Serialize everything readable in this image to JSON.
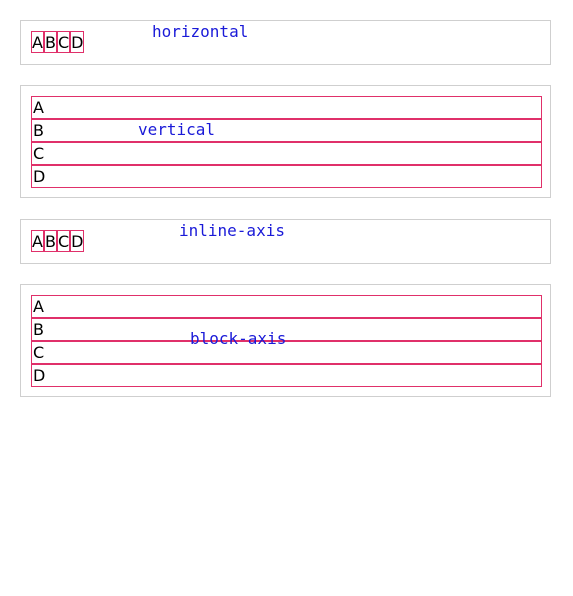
{
  "panels": [
    {
      "caption": "horizontal",
      "items": [
        "A",
        "B",
        "C",
        "D"
      ]
    },
    {
      "caption": "vertical",
      "items": [
        "A",
        "B",
        "C",
        "D"
      ]
    },
    {
      "caption": "inline-axis",
      "items": [
        "A",
        "B",
        "C",
        "D"
      ]
    },
    {
      "caption": "block-axis",
      "items": [
        "A",
        "B",
        "C",
        "D"
      ]
    }
  ],
  "colors": {
    "caption": "#1a1ad8",
    "item_border": "#e0306a",
    "panel_border": "#cfcfcf"
  }
}
